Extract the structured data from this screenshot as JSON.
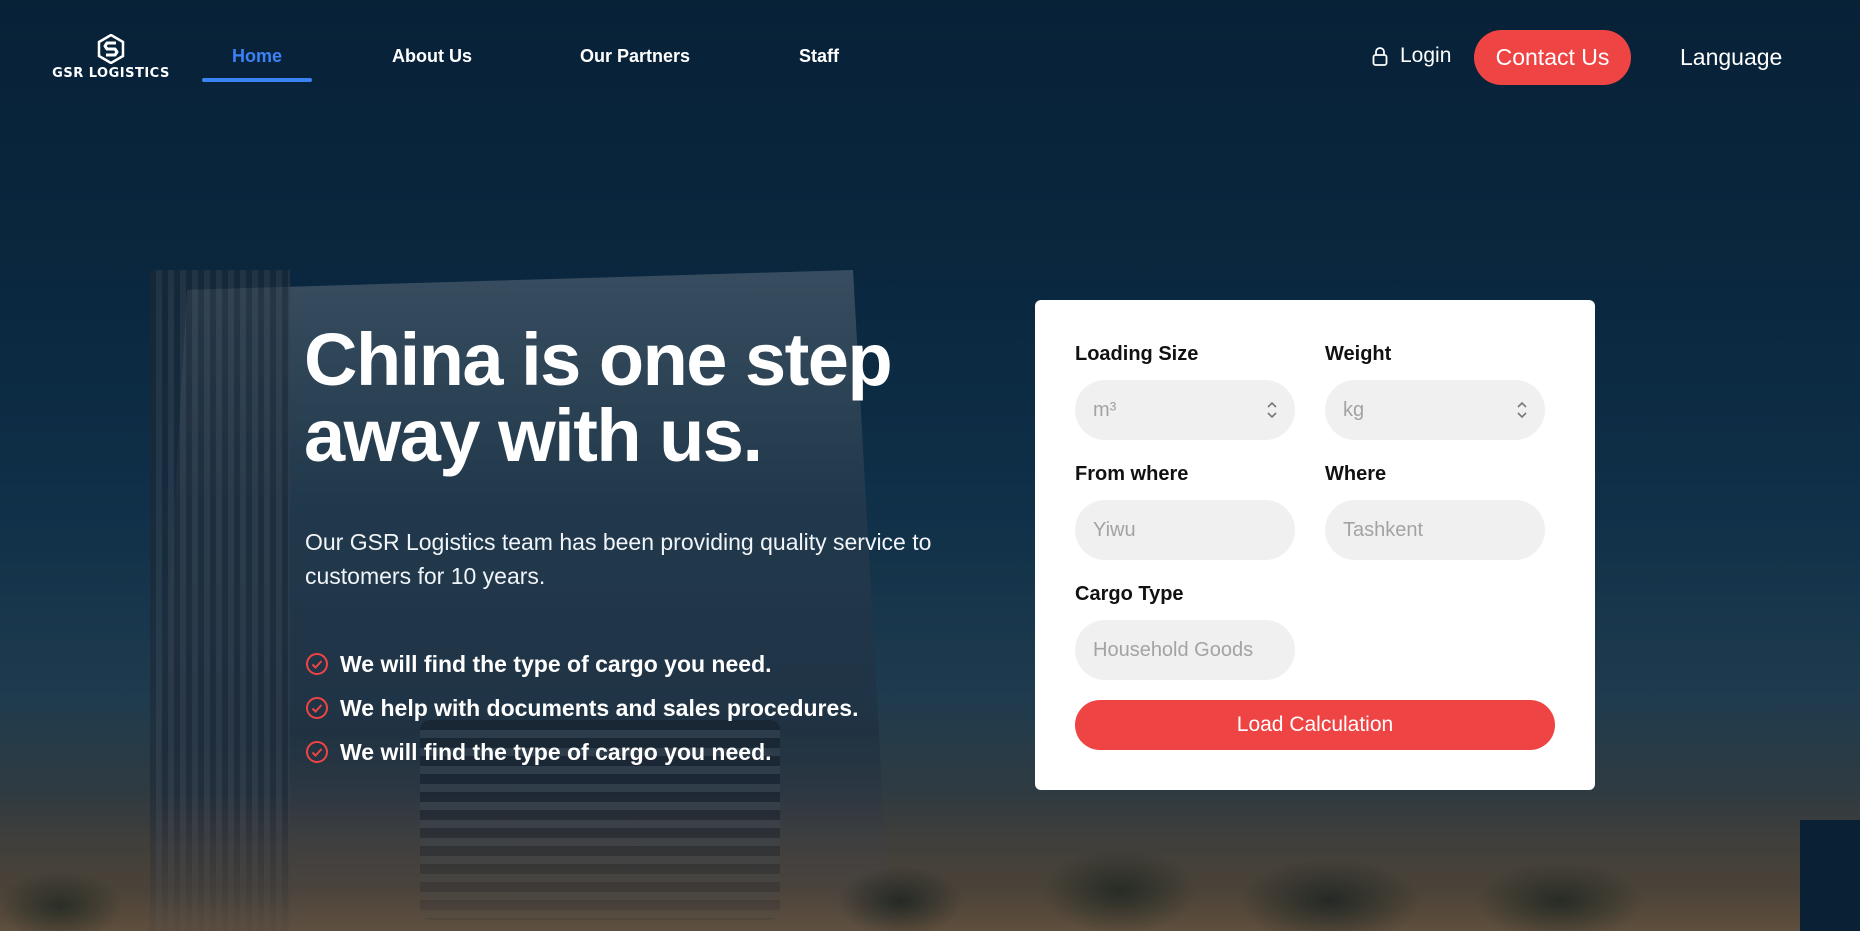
{
  "brand": {
    "name": "GSR LOGISTICS",
    "accent": "#ef4444",
    "link_active": "#3b82f6"
  },
  "nav": {
    "items": [
      {
        "label": "Home",
        "active": true
      },
      {
        "label": "About Us",
        "active": false
      },
      {
        "label": "Our Partners",
        "active": false
      },
      {
        "label": "Staff",
        "active": false
      }
    ],
    "login_label": "Login",
    "contact_label": "Contact Us",
    "language_label": "Language"
  },
  "hero": {
    "title_line1": "China is one step",
    "title_line2": "away with us.",
    "description": "Our GSR Logistics team has been providing quality service to customers for 10 years.",
    "features": [
      "We will find the type of cargo you need.",
      "We help with documents and sales procedures.",
      "We will find the type of cargo you need."
    ]
  },
  "calculator": {
    "loading_size": {
      "label": "Loading Size",
      "placeholder": "m³",
      "value": ""
    },
    "weight": {
      "label": "Weight",
      "placeholder": "kg",
      "value": ""
    },
    "from_where": {
      "label": "From where",
      "placeholder": "Yiwu",
      "value": ""
    },
    "where": {
      "label": "Where",
      "placeholder": "Tashkent",
      "value": ""
    },
    "cargo_type": {
      "label": "Cargo Type",
      "placeholder": "Household Goods",
      "value": ""
    },
    "submit_label": "Load Calculation"
  }
}
